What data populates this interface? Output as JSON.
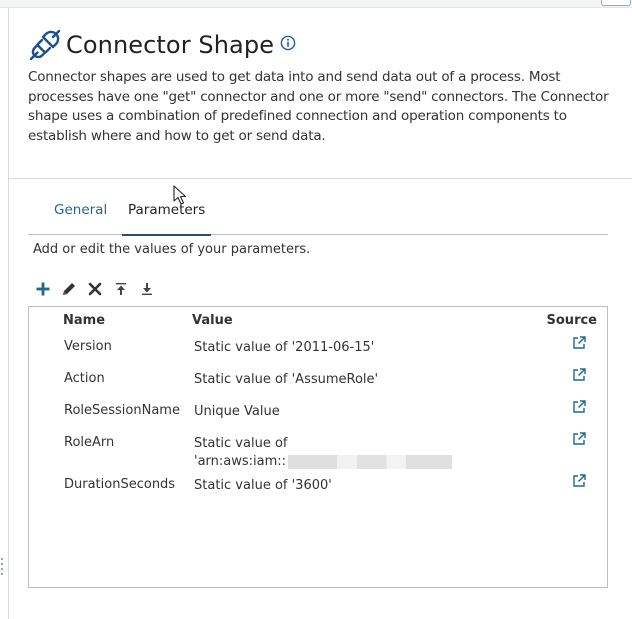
{
  "header": {
    "title": "Connector Shape",
    "description": "Connector shapes are used to get data into and send data out of a process. Most processes have one \"get\" connector and one or more \"send\" connectors. The Connector shape uses a combination of predefined connection and operation components to establish where and how to get or send data."
  },
  "icons": {
    "title_icon": "plug-icon",
    "info": "info-icon",
    "add": "plus-icon",
    "edit": "pencil-icon",
    "delete": "x-icon",
    "move_top": "move-to-top-icon",
    "move_bottom": "move-to-bottom-icon",
    "source": "external-link-icon"
  },
  "tabs": [
    {
      "label": "General",
      "active": false
    },
    {
      "label": "Parameters",
      "active": true
    }
  ],
  "parameters": {
    "hint": "Add or edit the values of your parameters.",
    "columns": {
      "name": "Name",
      "value": "Value",
      "source": "Source"
    },
    "rows": [
      {
        "name": "Version",
        "value": "Static value of '2011-06-15'"
      },
      {
        "name": "Action",
        "value": "Static value of 'AssumeRole'"
      },
      {
        "name": "RoleSessionName",
        "value": "Unique Value"
      },
      {
        "name": "RoleArn",
        "value": "Static value of",
        "value_line2": "'arn:aws:iam::"
      },
      {
        "name": "DurationSeconds",
        "value": "Static value of '3600'"
      }
    ]
  },
  "colors": {
    "accent": "#1e6a8d",
    "tab_underline": "#2a4d69",
    "icon_dark": "#333333",
    "plug_blue": "#1e4f8c"
  }
}
